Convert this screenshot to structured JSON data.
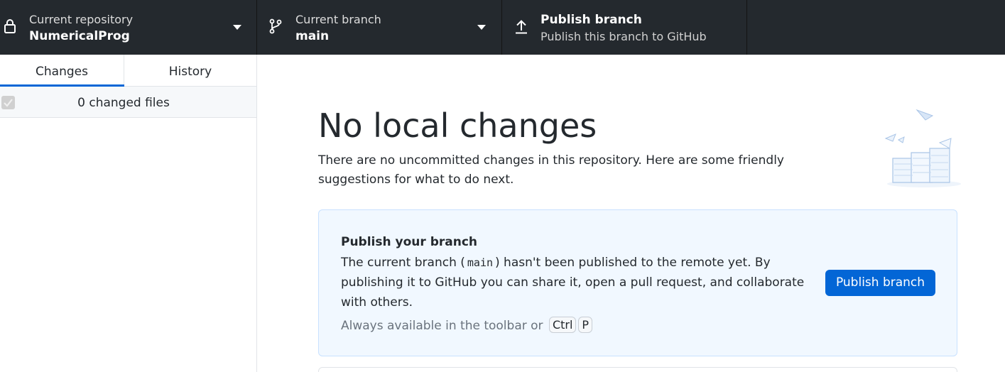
{
  "toolbar": {
    "repository": {
      "title": "Current repository",
      "value": "NumericalProg",
      "icon": "lock-icon"
    },
    "branch": {
      "title": "Current branch",
      "value": "main",
      "icon": "git-branch-icon"
    },
    "publish": {
      "title": "Publish branch",
      "subtitle": "Publish this branch to GitHub",
      "icon": "upload-icon"
    }
  },
  "sidebar": {
    "tabs": [
      {
        "label": "Changes",
        "active": true
      },
      {
        "label": "History",
        "active": false
      }
    ],
    "files_summary": "0 changed files"
  },
  "main": {
    "heading": "No local changes",
    "description": "There are no uncommitted changes in this repository. Here are some friendly suggestions for what to do next.",
    "card": {
      "title": "Publish your branch",
      "desc_before": "The current branch (",
      "branch_code": "main",
      "desc_after": ") hasn't been published to the remote yet. By publishing it to GitHub you can share it, open a pull request, and collaborate with others.",
      "hint": "Always available in the toolbar or",
      "shortcut_keys": [
        "Ctrl",
        "P"
      ],
      "button_label": "Publish branch"
    }
  },
  "colors": {
    "toolbar_bg": "#24292e",
    "accent": "#0366d6",
    "card_bg": "#f1f8ff",
    "card_border": "#c8e1ff"
  }
}
